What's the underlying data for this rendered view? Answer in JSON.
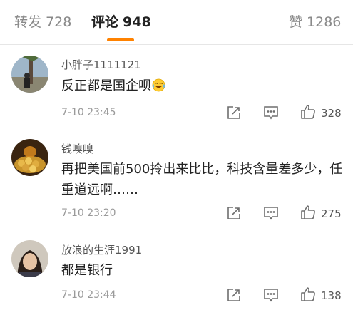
{
  "tabs": {
    "repost": {
      "label": "转发",
      "count": "728"
    },
    "comments": {
      "label": "评论",
      "count": "948"
    },
    "likes": {
      "label": "赞",
      "count": "1286"
    }
  },
  "comments": [
    {
      "username": "小胖子1111121",
      "text": "反正都是国企呗",
      "emoji": "laugh-cry-emoji",
      "time": "7-10 23:45",
      "likes": "328"
    },
    {
      "username": "钱嗅嗅",
      "text": "再把美国前500拎出来比比，科技含量差多少，任重道远啊……",
      "time": "7-10 23:20",
      "likes": "275"
    },
    {
      "username": "放浪的生涯1991",
      "text": "都是银行",
      "time": "7-10 23:44",
      "likes": "138"
    }
  ],
  "icons": {
    "repost": "edit-share-icon",
    "reply": "comment-bubble-icon",
    "like": "thumbs-up-icon"
  },
  "colors": {
    "accent": "#ff8200",
    "text": "#222222",
    "meta": "#9a9a9a"
  }
}
